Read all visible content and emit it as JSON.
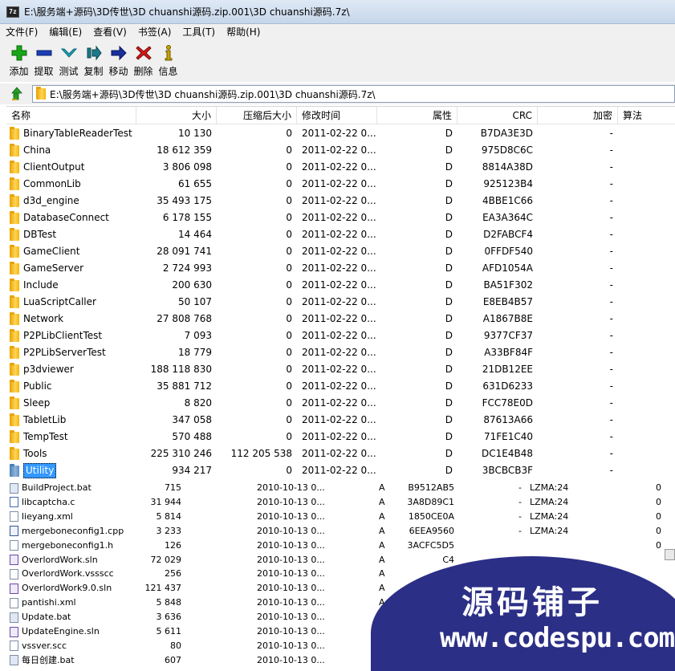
{
  "window": {
    "title": "E:\\服务端+源码\\3D传世\\3D chuanshi源码.zip.001\\3D chuanshi源码.7z\\",
    "app_icon_text": "7z"
  },
  "menu": [
    "文件(F)",
    "编辑(E)",
    "查看(V)",
    "书签(A)",
    "工具(T)",
    "帮助(H)"
  ],
  "toolbar": [
    {
      "label": "添加",
      "icon": "add-icon",
      "color": "#19a619"
    },
    {
      "label": "提取",
      "icon": "extract-icon",
      "color": "#1a3fb5"
    },
    {
      "label": "测试",
      "icon": "test-icon",
      "color": "#1fa3b8"
    },
    {
      "label": "复制",
      "icon": "copy-icon",
      "color": "#1a7a8a"
    },
    {
      "label": "移动",
      "icon": "move-icon",
      "color": "#1a2f9a"
    },
    {
      "label": "删除",
      "icon": "delete-icon",
      "color": "#d11a1a"
    },
    {
      "label": "信息",
      "icon": "info-icon",
      "color": "#c9a400"
    }
  ],
  "address": {
    "path": "E:\\服务端+源码\\3D传世\\3D chuanshi源码.zip.001\\3D chuanshi源码.7z\\"
  },
  "columns": {
    "name": "名称",
    "size": "大小",
    "packed": "压缩后大小",
    "mtime": "修改时间",
    "attr": "属性",
    "crc": "CRC",
    "encrypted": "加密",
    "method": "算法"
  },
  "rows": [
    {
      "name": "BinaryTableReaderTest",
      "size": "10 130",
      "packed": "0",
      "mtime": "2011-02-22 0...",
      "attr": "D",
      "crc": "B7DA3E3D",
      "enc": "-"
    },
    {
      "name": "China",
      "size": "18 612 359",
      "packed": "0",
      "mtime": "2011-02-22 0...",
      "attr": "D",
      "crc": "975D8C6C",
      "enc": "-"
    },
    {
      "name": "ClientOutput",
      "size": "3 806 098",
      "packed": "0",
      "mtime": "2011-02-22 0...",
      "attr": "D",
      "crc": "8814A38D",
      "enc": "-"
    },
    {
      "name": "CommonLib",
      "size": "61 655",
      "packed": "0",
      "mtime": "2011-02-22 0...",
      "attr": "D",
      "crc": "925123B4",
      "enc": "-"
    },
    {
      "name": "d3d_engine",
      "size": "35 493 175",
      "packed": "0",
      "mtime": "2011-02-22 0...",
      "attr": "D",
      "crc": "4BBE1C66",
      "enc": "-"
    },
    {
      "name": "DatabaseConnect",
      "size": "6 178 155",
      "packed": "0",
      "mtime": "2011-02-22 0...",
      "attr": "D",
      "crc": "EA3A364C",
      "enc": "-"
    },
    {
      "name": "DBTest",
      "size": "14 464",
      "packed": "0",
      "mtime": "2011-02-22 0...",
      "attr": "D",
      "crc": "D2FABCF4",
      "enc": "-"
    },
    {
      "name": "GameClient",
      "size": "28 091 741",
      "packed": "0",
      "mtime": "2011-02-22 0...",
      "attr": "D",
      "crc": "0FFDF540",
      "enc": "-"
    },
    {
      "name": "GameServer",
      "size": "2 724 993",
      "packed": "0",
      "mtime": "2011-02-22 0...",
      "attr": "D",
      "crc": "AFD1054A",
      "enc": "-"
    },
    {
      "name": "Include",
      "size": "200 630",
      "packed": "0",
      "mtime": "2011-02-22 0...",
      "attr": "D",
      "crc": "BA51F302",
      "enc": "-"
    },
    {
      "name": "LuaScriptCaller",
      "size": "50 107",
      "packed": "0",
      "mtime": "2011-02-22 0...",
      "attr": "D",
      "crc": "E8EB4B57",
      "enc": "-"
    },
    {
      "name": "Network",
      "size": "27 808 768",
      "packed": "0",
      "mtime": "2011-02-22 0...",
      "attr": "D",
      "crc": "A1867B8E",
      "enc": "-"
    },
    {
      "name": "P2PLibClientTest",
      "size": "7 093",
      "packed": "0",
      "mtime": "2011-02-22 0...",
      "attr": "D",
      "crc": "9377CF37",
      "enc": "-"
    },
    {
      "name": "P2PLibServerTest",
      "size": "18 779",
      "packed": "0",
      "mtime": "2011-02-22 0...",
      "attr": "D",
      "crc": "A33BF84F",
      "enc": "-"
    },
    {
      "name": "p3dviewer",
      "size": "188 118 830",
      "packed": "0",
      "mtime": "2011-02-22 0...",
      "attr": "D",
      "crc": "21DB12EE",
      "enc": "-"
    },
    {
      "name": "Public",
      "size": "35 881 712",
      "packed": "0",
      "mtime": "2011-02-22 0...",
      "attr": "D",
      "crc": "631D6233",
      "enc": "-"
    },
    {
      "name": "Sleep",
      "size": "8 820",
      "packed": "0",
      "mtime": "2011-02-22 0...",
      "attr": "D",
      "crc": "FCC78E0D",
      "enc": "-"
    },
    {
      "name": "TabletLib",
      "size": "347 058",
      "packed": "0",
      "mtime": "2011-02-22 0...",
      "attr": "D",
      "crc": "87613A66",
      "enc": "-"
    },
    {
      "name": "TempTest",
      "size": "570 488",
      "packed": "0",
      "mtime": "2011-02-22 0...",
      "attr": "D",
      "crc": "71FE1C40",
      "enc": "-"
    },
    {
      "name": "Tools",
      "size": "225 310 246",
      "packed": "112 205 538",
      "mtime": "2011-02-22 0...",
      "attr": "D",
      "crc": "DC1E4B48",
      "enc": "-"
    },
    {
      "name": "Utility",
      "size": "934 217",
      "packed": "0",
      "mtime": "2011-02-22 0...",
      "attr": "D",
      "crc": "3BCBCB3F",
      "enc": "-",
      "selected": true
    }
  ],
  "lower_rows": [
    {
      "name": "BuildProject.bat",
      "type": "bat",
      "size": "715",
      "mtime": "2010-10-13 0...",
      "attr": "A",
      "crc": "B9512AB5",
      "enc": "-",
      "method": "LZMA:24",
      "zero": "0"
    },
    {
      "name": "libcaptcha.c",
      "type": "c",
      "size": "31 944",
      "mtime": "2010-10-13 0...",
      "attr": "A",
      "crc": "3A8D89C1",
      "enc": "-",
      "method": "LZMA:24",
      "zero": "0"
    },
    {
      "name": "lieyang.xml",
      "type": "xml",
      "size": "5 814",
      "mtime": "2010-10-13 0...",
      "attr": "A",
      "crc": "1850CE0A",
      "enc": "-",
      "method": "LZMA:24",
      "zero": "0"
    },
    {
      "name": "mergeboneconfig1.cpp",
      "type": "cpp",
      "size": "3 233",
      "mtime": "2010-10-13 0...",
      "attr": "A",
      "crc": "6EEA9560",
      "enc": "-",
      "method": "LZMA:24",
      "zero": "0"
    },
    {
      "name": "mergeboneconfig1.h",
      "type": "h",
      "size": "126",
      "mtime": "2010-10-13 0...",
      "attr": "A",
      "crc": "3ACFC5D5",
      "enc": "",
      "method": "",
      "zero": "0"
    },
    {
      "name": "OverlordWork.sln",
      "type": "sln",
      "size": "72 029",
      "mtime": "2010-10-13 0...",
      "attr": "A",
      "crc": "C4",
      "enc": "",
      "method": "",
      "zero": ""
    },
    {
      "name": "OverlordWork.vssscc",
      "type": "vss",
      "size": "256",
      "mtime": "2010-10-13 0...",
      "attr": "A",
      "crc": "",
      "enc": "",
      "method": "",
      "zero": ""
    },
    {
      "name": "OverlordWork9.0.sln",
      "type": "sln",
      "size": "121 437",
      "mtime": "2010-10-13 0...",
      "attr": "A",
      "crc": "",
      "enc": "",
      "method": "",
      "zero": ""
    },
    {
      "name": "pantishi.xml",
      "type": "xml",
      "size": "5 848",
      "mtime": "2010-10-13 0...",
      "attr": "A",
      "crc": "",
      "enc": "",
      "method": "",
      "zero": ""
    },
    {
      "name": "Update.bat",
      "type": "bat",
      "size": "3 636",
      "mtime": "2010-10-13 0...",
      "attr": "A",
      "crc": "",
      "enc": "",
      "method": "",
      "zero": ""
    },
    {
      "name": "UpdateEngine.sln",
      "type": "sln",
      "size": "5 611",
      "mtime": "2010-10-13 0...",
      "attr": "A",
      "crc": "",
      "enc": "",
      "method": "",
      "zero": ""
    },
    {
      "name": "vssver.scc",
      "type": "scc",
      "size": "80",
      "mtime": "2010-10-13 0...",
      "attr": "A",
      "crc": "",
      "enc": "",
      "method": "",
      "zero": ""
    },
    {
      "name": "每日创建.bat",
      "type": "bat",
      "size": "607",
      "mtime": "2010-10-13 0...",
      "attr": "A",
      "crc": "",
      "enc": "",
      "method": "",
      "zero": ""
    }
  ],
  "watermark": {
    "cn": "源码铺子",
    "url": "www.codespu.com"
  }
}
